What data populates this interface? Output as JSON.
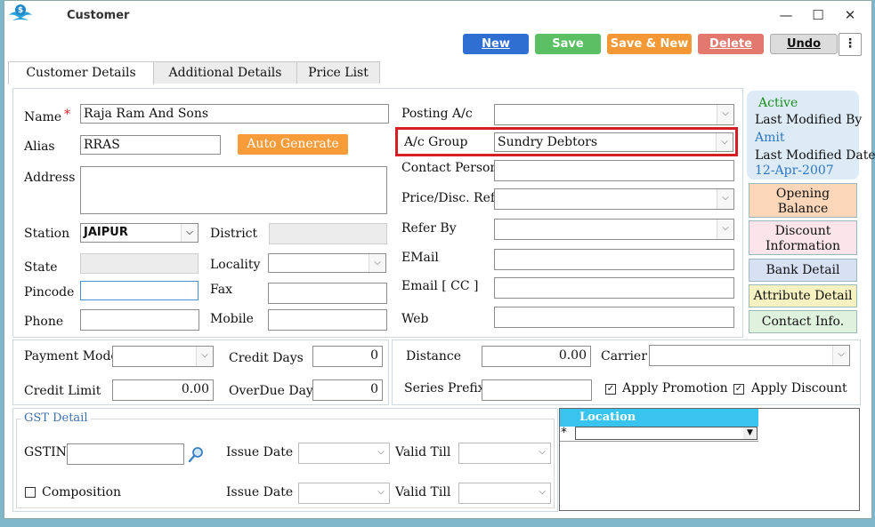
{
  "window": {
    "title": "Customer"
  },
  "toolbar": {
    "new": "New",
    "save": "Save",
    "save_new": "Save & New",
    "delete": "Delete",
    "undo": "Undo",
    "more": "⋮",
    "colors": {
      "new": "#2f6fd1",
      "save": "#5bbf63",
      "save_new": "#f49836",
      "delete": "#e3786e",
      "undo": "#dcdcdc"
    }
  },
  "tabs": [
    "Customer Details",
    "Additional Details",
    "Price List"
  ],
  "form": {
    "name_label": "Name",
    "required_mark": "*",
    "name_value": "Raja Ram And Sons",
    "alias_label": "Alias",
    "alias_value": "RRAS",
    "auto_generate": "Auto Generate",
    "address_label": "Address",
    "station_label": "Station",
    "station_value": "JAIPUR",
    "district_label": "District",
    "state_label": "State",
    "locality_label": "Locality",
    "pincode_label": "Pincode",
    "fax_label": "Fax",
    "phone_label": "Phone",
    "mobile_label": "Mobile",
    "posting_label": "Posting A/c",
    "acgroup_label": "A/c Group",
    "acgroup_value": "Sundry Debtors",
    "contact_person_label": "Contact Person",
    "price_ref_label": "Price/Disc. Ref.",
    "refer_by_label": "Refer By",
    "email_label": "EMail",
    "email_cc_label": "Email [ CC ]",
    "web_label": "Web"
  },
  "status": {
    "active": "Active",
    "modified_by_label": "Last Modified By",
    "modified_by": "Amit",
    "modified_date_label": "Last Modified Date",
    "modified_date": "12-Apr-2007"
  },
  "side_buttons": {
    "opening_balance": [
      "Opening",
      "Balance"
    ],
    "discount_info": [
      "Discount",
      "Information"
    ],
    "bank_detail": "Bank Detail",
    "attribute_detail": "Attribute Detail",
    "contact_info": "Contact Info."
  },
  "payment": {
    "payment_mode_label": "Payment Mode",
    "credit_days_label": "Credit Days",
    "credit_days": "0",
    "credit_limit_label": "Credit Limit",
    "credit_limit": "0.00",
    "overdue_label": "OverDue Days",
    "overdue": "0"
  },
  "logistics": {
    "distance_label": "Distance",
    "distance": "0.00",
    "carrier_label": "Carrier",
    "series_prefix_label": "Series Prefix",
    "apply_promotion": "Apply Promotion",
    "apply_discount": "Apply Discount"
  },
  "gst": {
    "title": "GST Detail",
    "gstin_label": "GSTIN",
    "issue_date_label": "Issue Date",
    "valid_till_label": "Valid Till",
    "composition_label": "Composition"
  },
  "location": {
    "header": "Location",
    "new_row_marker": "*"
  }
}
